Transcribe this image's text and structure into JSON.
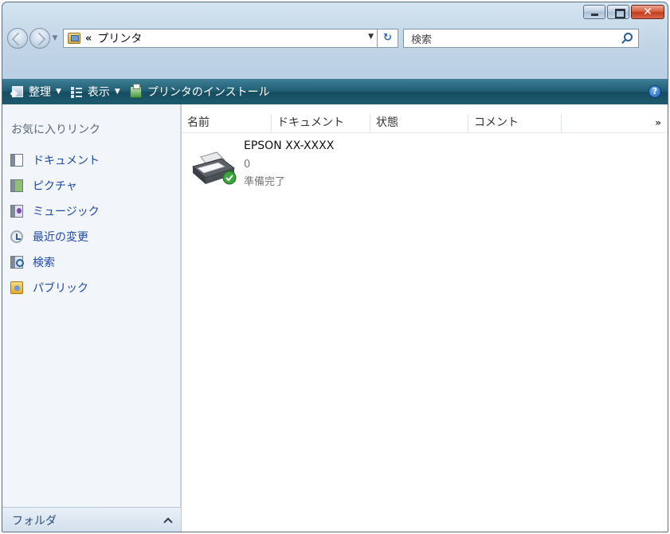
{
  "address": {
    "breadcrumb_chevron": "«",
    "location": "プリンタ"
  },
  "search": {
    "placeholder": "検索"
  },
  "toolbar": {
    "organize": "整理",
    "views": "表示",
    "install_printer": "プリンタのインストール"
  },
  "sidebar": {
    "header": "お気に入りリンク",
    "items": [
      {
        "label": "ドキュメント",
        "icon": "documents-icon"
      },
      {
        "label": "ピクチャ",
        "icon": "pictures-icon"
      },
      {
        "label": "ミュージック",
        "icon": "music-icon"
      },
      {
        "label": "最近の変更",
        "icon": "recent-changes-icon"
      },
      {
        "label": "検索",
        "icon": "searches-icon"
      },
      {
        "label": "パブリック",
        "icon": "public-folder-icon"
      }
    ],
    "folders_label": "フォルダ"
  },
  "columns": [
    "名前",
    "ドキュメント",
    "状態",
    "コメント",
    "»"
  ],
  "printers": [
    {
      "name": "EPSON XX-XXXX",
      "documents": "0",
      "status": "準備完了"
    }
  ],
  "colors": {
    "toolbar": "#1f5d73",
    "link": "#1f4aa8",
    "close_button": "#c23a1d"
  }
}
